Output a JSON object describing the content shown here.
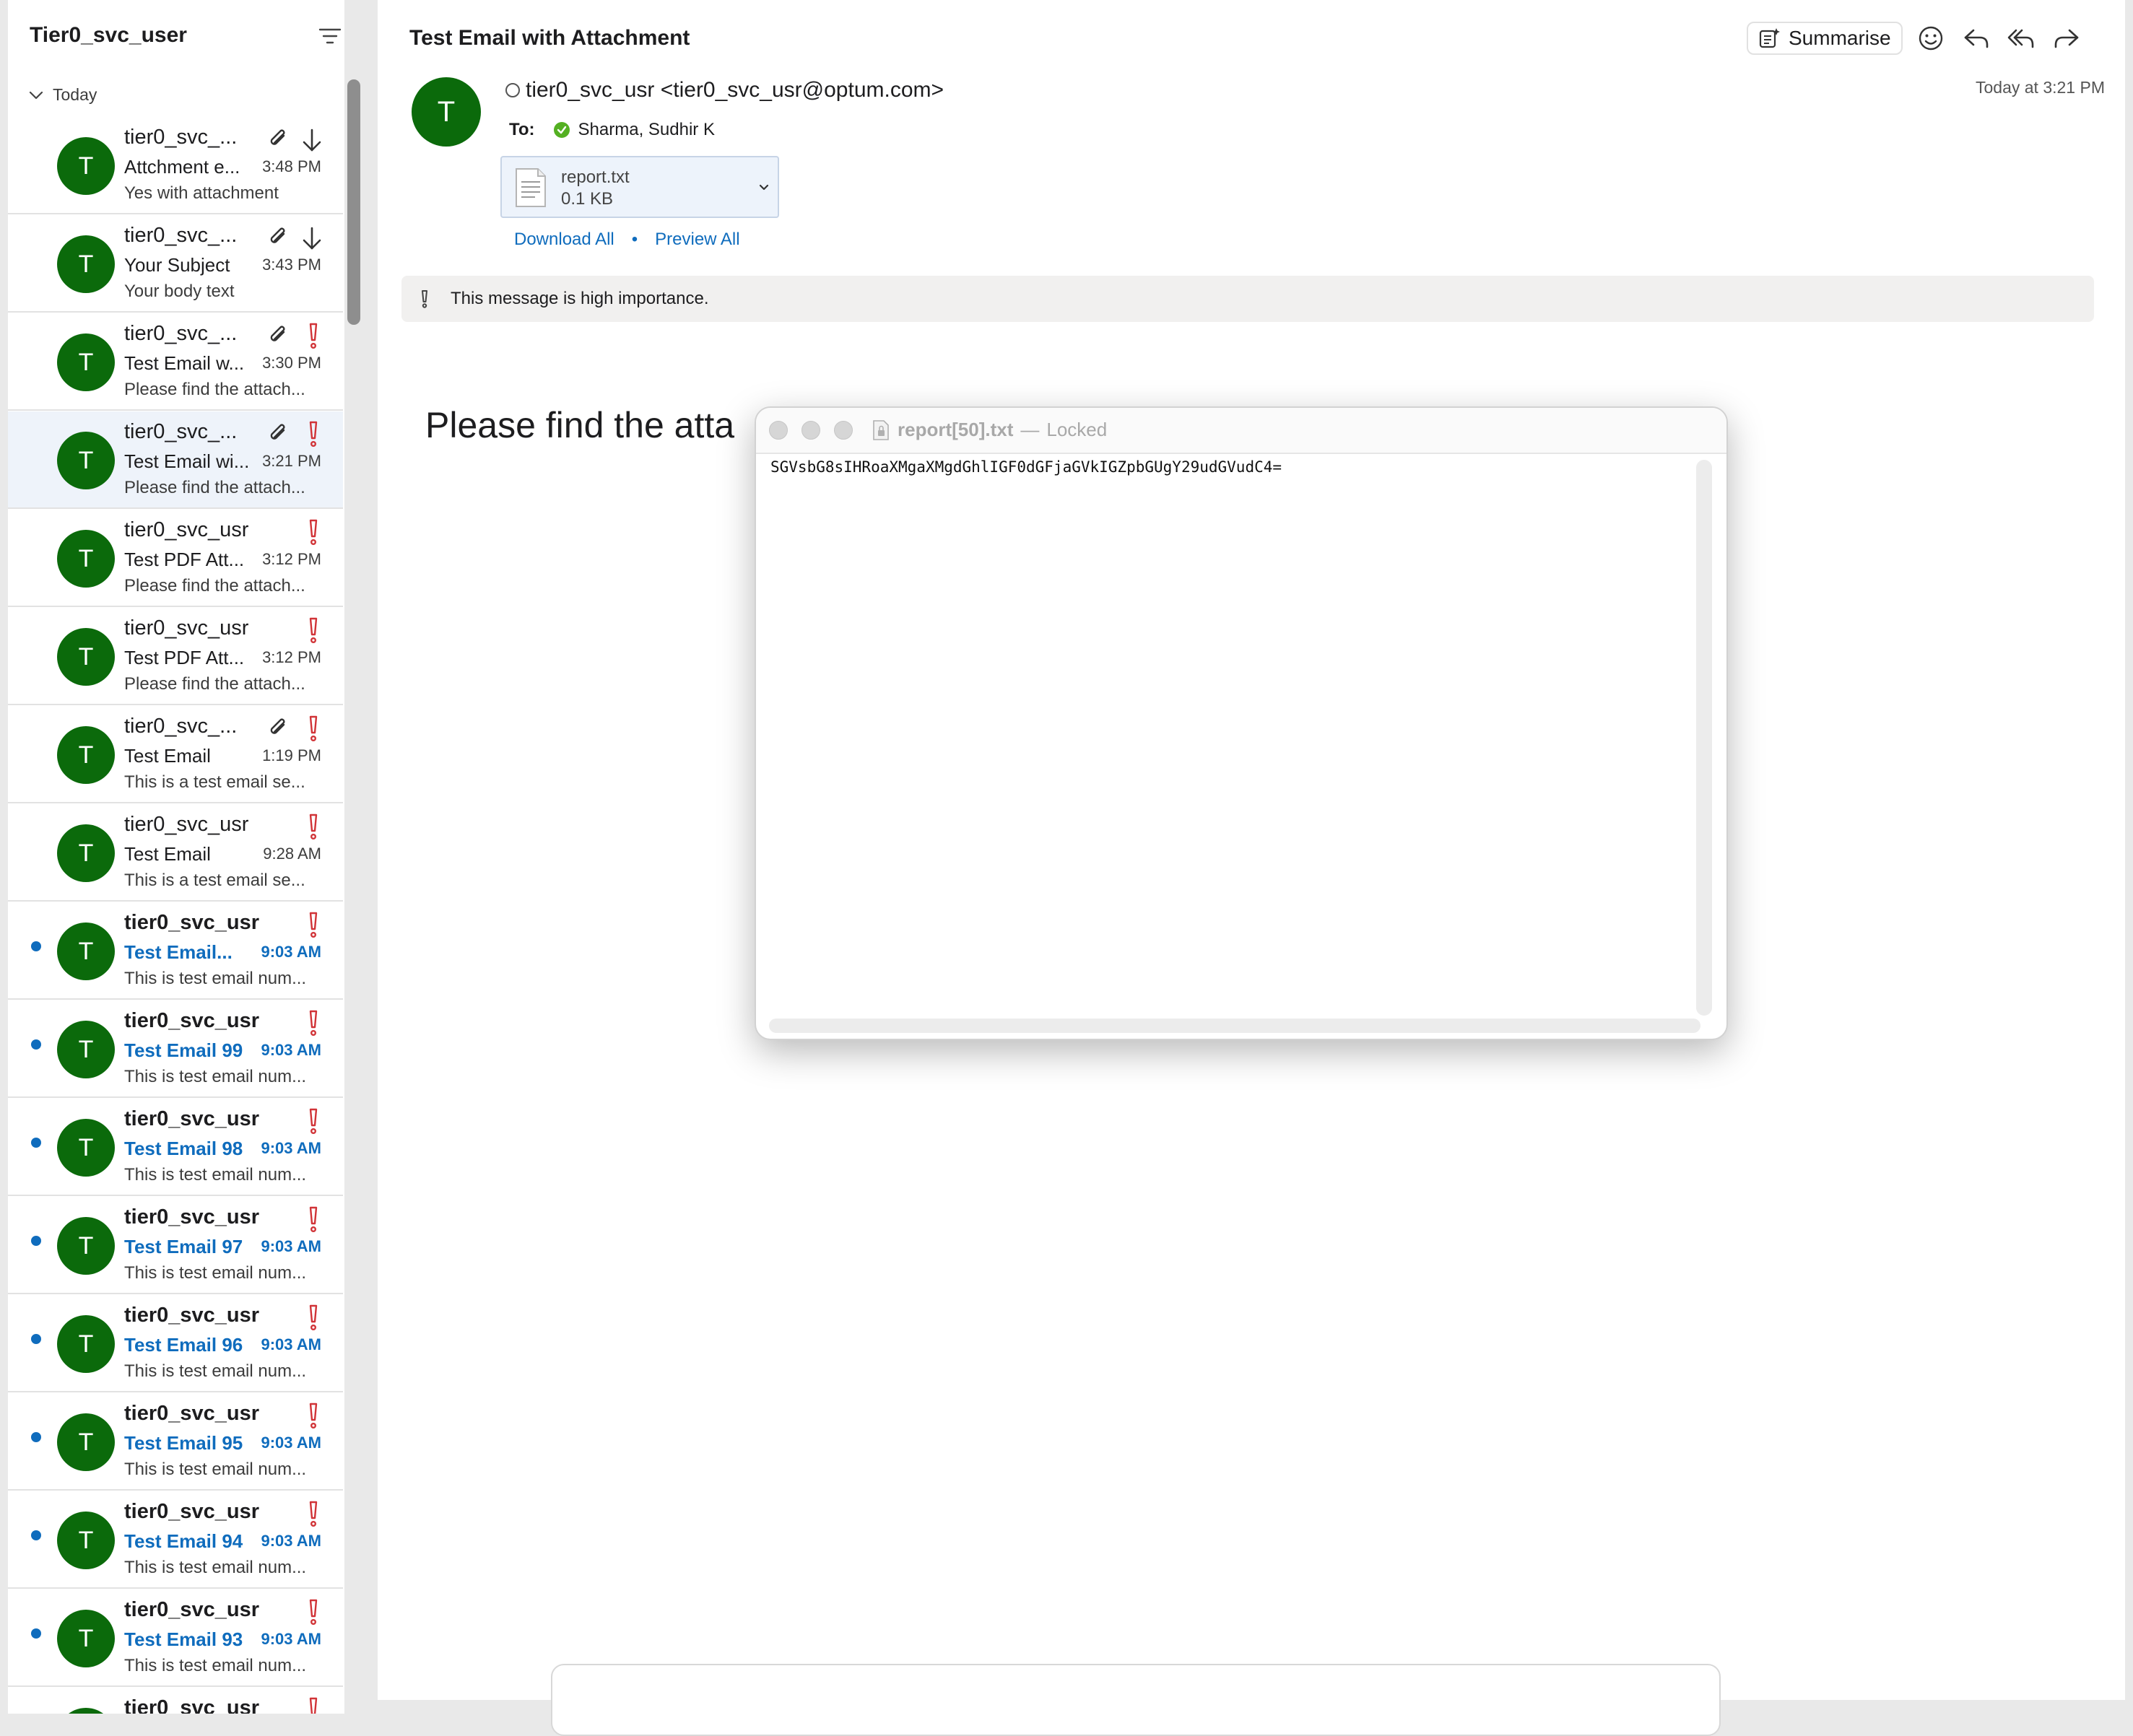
{
  "list": {
    "title": "Tier0_svc_user",
    "group_label": "Today",
    "items": [
      {
        "sender": "tier0_svc_...",
        "subject": "Attchment e...",
        "time": "3:48 PM",
        "preview": "Yes with attachment",
        "unread": false,
        "selected": false,
        "attachment": true,
        "downloaded": true,
        "important": false
      },
      {
        "sender": "tier0_svc_...",
        "subject": "Your Subject",
        "time": "3:43 PM",
        "preview": "Your body text",
        "unread": false,
        "selected": false,
        "attachment": true,
        "downloaded": true,
        "important": false
      },
      {
        "sender": "tier0_svc_...",
        "subject": "Test Email w...",
        "time": "3:30 PM",
        "preview": "Please find the attach...",
        "unread": false,
        "selected": false,
        "attachment": true,
        "downloaded": false,
        "important": true
      },
      {
        "sender": "tier0_svc_...",
        "subject": "Test Email wi...",
        "time": "3:21 PM",
        "preview": "Please find the attach...",
        "unread": false,
        "selected": true,
        "attachment": true,
        "downloaded": false,
        "important": true
      },
      {
        "sender": "tier0_svc_usr",
        "subject": "Test PDF Att...",
        "time": "3:12 PM",
        "preview": "Please find the attach...",
        "unread": false,
        "selected": false,
        "attachment": false,
        "downloaded": false,
        "important": true
      },
      {
        "sender": "tier0_svc_usr",
        "subject": "Test PDF Att...",
        "time": "3:12 PM",
        "preview": "Please find the attach...",
        "unread": false,
        "selected": false,
        "attachment": false,
        "downloaded": false,
        "important": true
      },
      {
        "sender": "tier0_svc_...",
        "subject": "Test Email",
        "time": "1:19 PM",
        "preview": "This is a test email se...",
        "unread": false,
        "selected": false,
        "attachment": true,
        "downloaded": false,
        "important": true
      },
      {
        "sender": "tier0_svc_usr",
        "subject": "Test Email",
        "time": "9:28 AM",
        "preview": "This is a test email se...",
        "unread": false,
        "selected": false,
        "attachment": false,
        "downloaded": false,
        "important": true
      },
      {
        "sender": "tier0_svc_usr",
        "subject": "Test Email...",
        "time": "9:03 AM",
        "preview": "This is test email num...",
        "unread": true,
        "selected": false,
        "attachment": false,
        "downloaded": false,
        "important": true
      },
      {
        "sender": "tier0_svc_usr",
        "subject": "Test Email 99",
        "time": "9:03 AM",
        "preview": "This is test email num...",
        "unread": true,
        "selected": false,
        "attachment": false,
        "downloaded": false,
        "important": true
      },
      {
        "sender": "tier0_svc_usr",
        "subject": "Test Email 98",
        "time": "9:03 AM",
        "preview": "This is test email num...",
        "unread": true,
        "selected": false,
        "attachment": false,
        "downloaded": false,
        "important": true
      },
      {
        "sender": "tier0_svc_usr",
        "subject": "Test Email 97",
        "time": "9:03 AM",
        "preview": "This is test email num...",
        "unread": true,
        "selected": false,
        "attachment": false,
        "downloaded": false,
        "important": true
      },
      {
        "sender": "tier0_svc_usr",
        "subject": "Test Email 96",
        "time": "9:03 AM",
        "preview": "This is test email num...",
        "unread": true,
        "selected": false,
        "attachment": false,
        "downloaded": false,
        "important": true
      },
      {
        "sender": "tier0_svc_usr",
        "subject": "Test Email 95",
        "time": "9:03 AM",
        "preview": "This is test email num...",
        "unread": true,
        "selected": false,
        "attachment": false,
        "downloaded": false,
        "important": true
      },
      {
        "sender": "tier0_svc_usr",
        "subject": "Test Email 94",
        "time": "9:03 AM",
        "preview": "This is test email num...",
        "unread": true,
        "selected": false,
        "attachment": false,
        "downloaded": false,
        "important": true
      },
      {
        "sender": "tier0_svc_usr",
        "subject": "Test Email 93",
        "time": "9:03 AM",
        "preview": "This is test email num...",
        "unread": true,
        "selected": false,
        "attachment": false,
        "downloaded": false,
        "important": true
      },
      {
        "sender": "tier0_svc_usr",
        "subject": "",
        "time": "",
        "preview": "",
        "unread": true,
        "selected": false,
        "attachment": false,
        "downloaded": false,
        "important": true
      }
    ],
    "avatar_initial": "T",
    "colors": {
      "avatar": "#0b6a0b",
      "unread_accent": "#0f6cbd",
      "importance": "#d13438"
    }
  },
  "message": {
    "subject": "Test Email with Attachment",
    "summarise_label": "Summarise",
    "avatar_initial": "T",
    "from": "tier0_svc_usr <tier0_svc_usr@optum.com>",
    "received": "Today at 3:21 PM",
    "to_label": "To:",
    "to_name": "Sharma, Sudhir K",
    "attachment": {
      "name": "report.txt",
      "size": "0.1 KB"
    },
    "download_all": "Download All",
    "separator": "•",
    "preview_all": "Preview All",
    "importance_notice": "This message is high importance.",
    "body": "Please find the atta"
  },
  "viewer": {
    "filename": "report[50].txt",
    "dash": "—",
    "state": "Locked",
    "content": "SGVsbG8sIHRoaXMgaXMgdGhlIGF0dGFjaGVkIGZpbGUgY29udGVudC4="
  }
}
